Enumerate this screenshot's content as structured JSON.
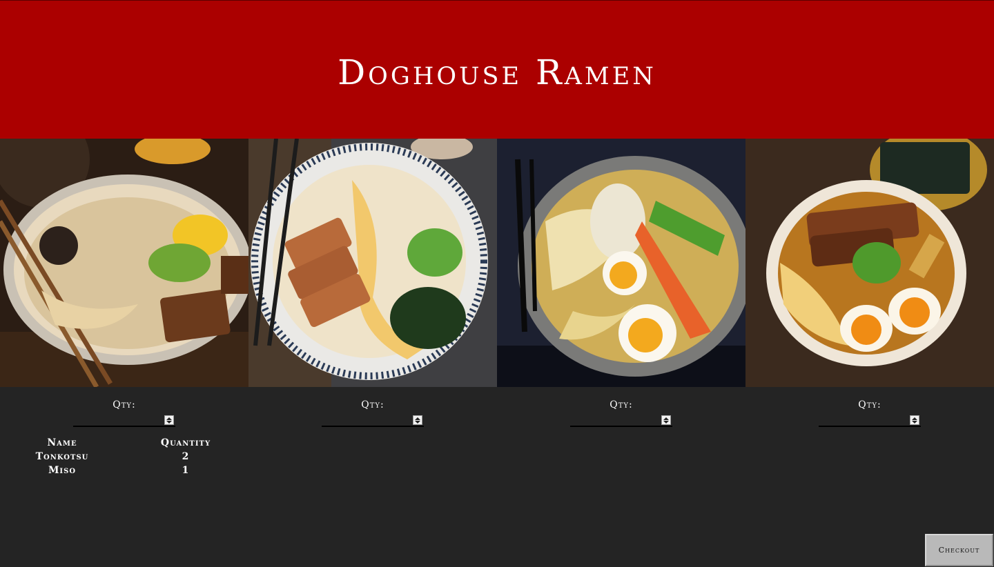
{
  "header": {
    "title": "Doghouse Ramen"
  },
  "menu": {
    "items": [
      {
        "image": "tonkotsu-bowl-image",
        "qty_label": "Qty:",
        "qty_value": ""
      },
      {
        "image": "shoyu-bowl-image",
        "qty_label": "Qty:",
        "qty_value": ""
      },
      {
        "image": "miso-chicken-bowl-image",
        "qty_label": "Qty:",
        "qty_value": ""
      },
      {
        "image": "chashu-bowl-image",
        "qty_label": "Qty:",
        "qty_value": ""
      }
    ]
  },
  "order": {
    "headers": {
      "name": "Name",
      "quantity": "Quantity"
    },
    "rows": [
      {
        "name": "Tonkotsu",
        "quantity": "2"
      },
      {
        "name": "Miso",
        "quantity": "1"
      }
    ]
  },
  "checkout": {
    "label": "Checkout"
  },
  "colors": {
    "header_bg": "#ab0000",
    "body_bg": "#242424"
  }
}
